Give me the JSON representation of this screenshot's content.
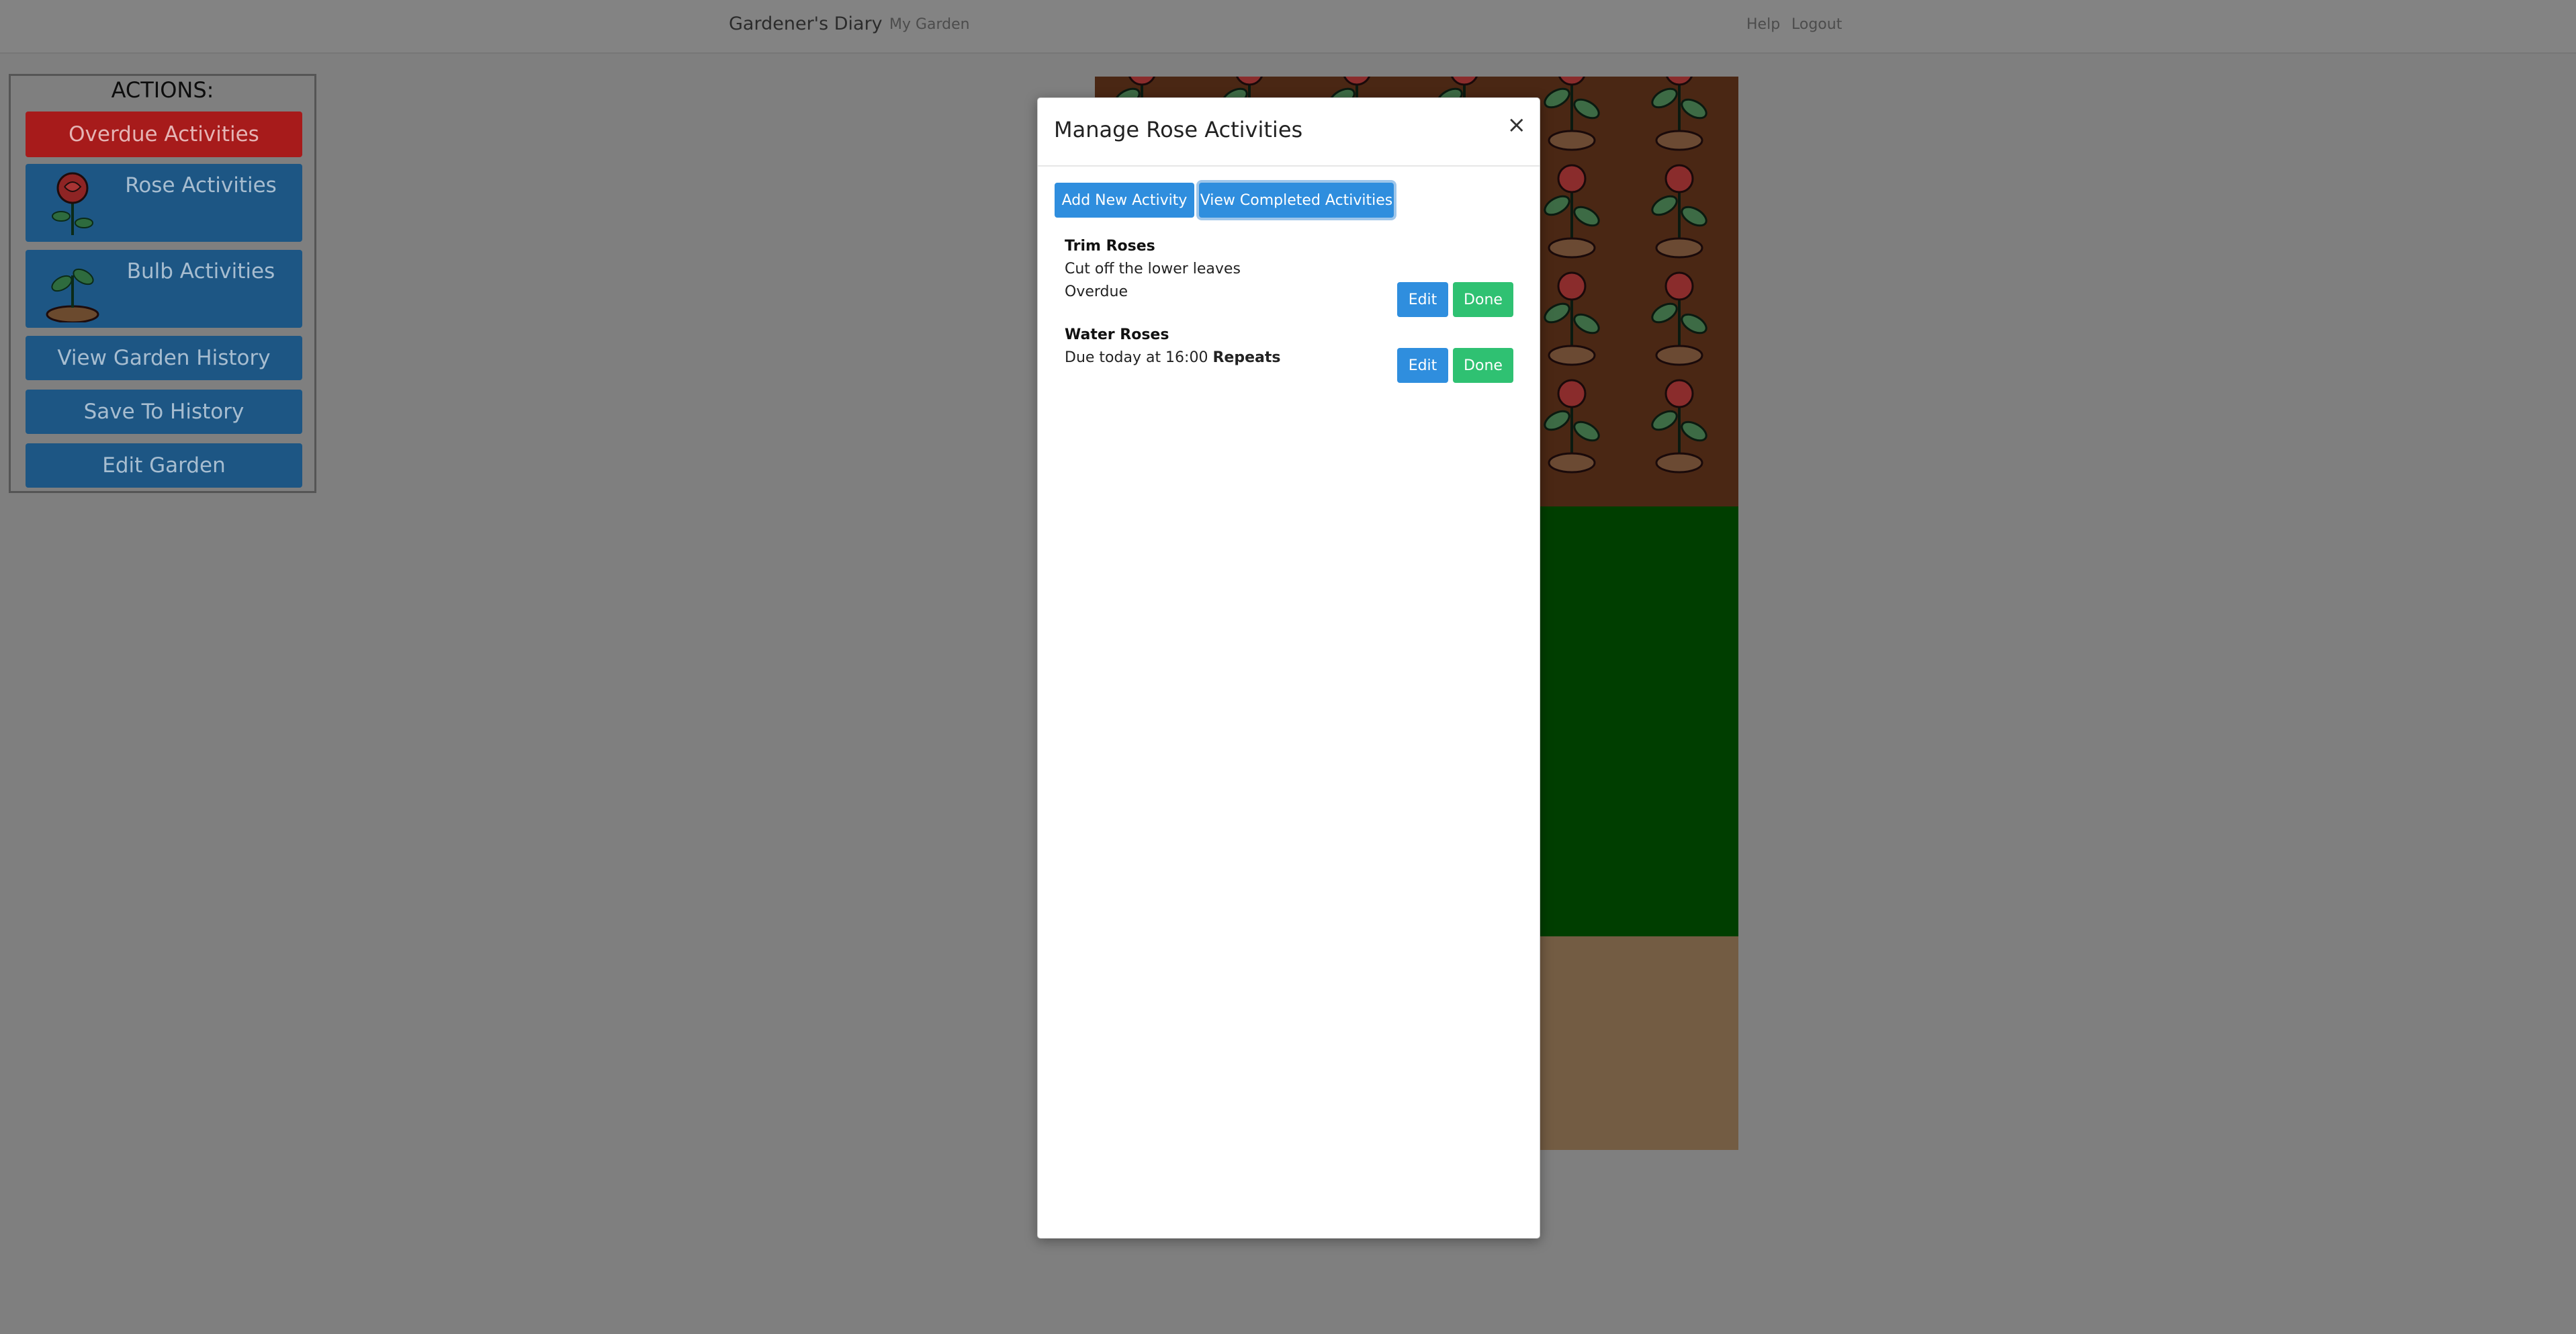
{
  "navbar": {
    "brand": "Gardener's Diary",
    "my_garden": "My Garden",
    "help": "Help",
    "logout": "Logout"
  },
  "actions": {
    "title": "ACTIONS:",
    "overdue": "Overdue Activities",
    "rose": "Rose Activities",
    "bulb": "Bulb Activities",
    "history": "View Garden History",
    "save": "Save To History",
    "edit": "Edit Garden"
  },
  "modal": {
    "title": "Manage Rose Activities",
    "close": "×",
    "add_button": "Add New Activity",
    "completed_button": "View Completed Activities",
    "activities": [
      {
        "name": "Trim Roses",
        "description": "Cut off the lower leaves",
        "status": "Overdue",
        "edit": "Edit",
        "done": "Done"
      },
      {
        "name": "Water Roses",
        "due": "Due today at 16:00",
        "repeats": "Repeats",
        "edit": "Edit",
        "done": "Done"
      }
    ]
  },
  "colors": {
    "overlay": "#7f7f7f",
    "primary": "#2f8ede",
    "success": "#2fc172",
    "danger": "#a71b1b",
    "garden_soil_bed": "#4a2714",
    "lawn": "#003e00",
    "soil": "#735c43"
  }
}
